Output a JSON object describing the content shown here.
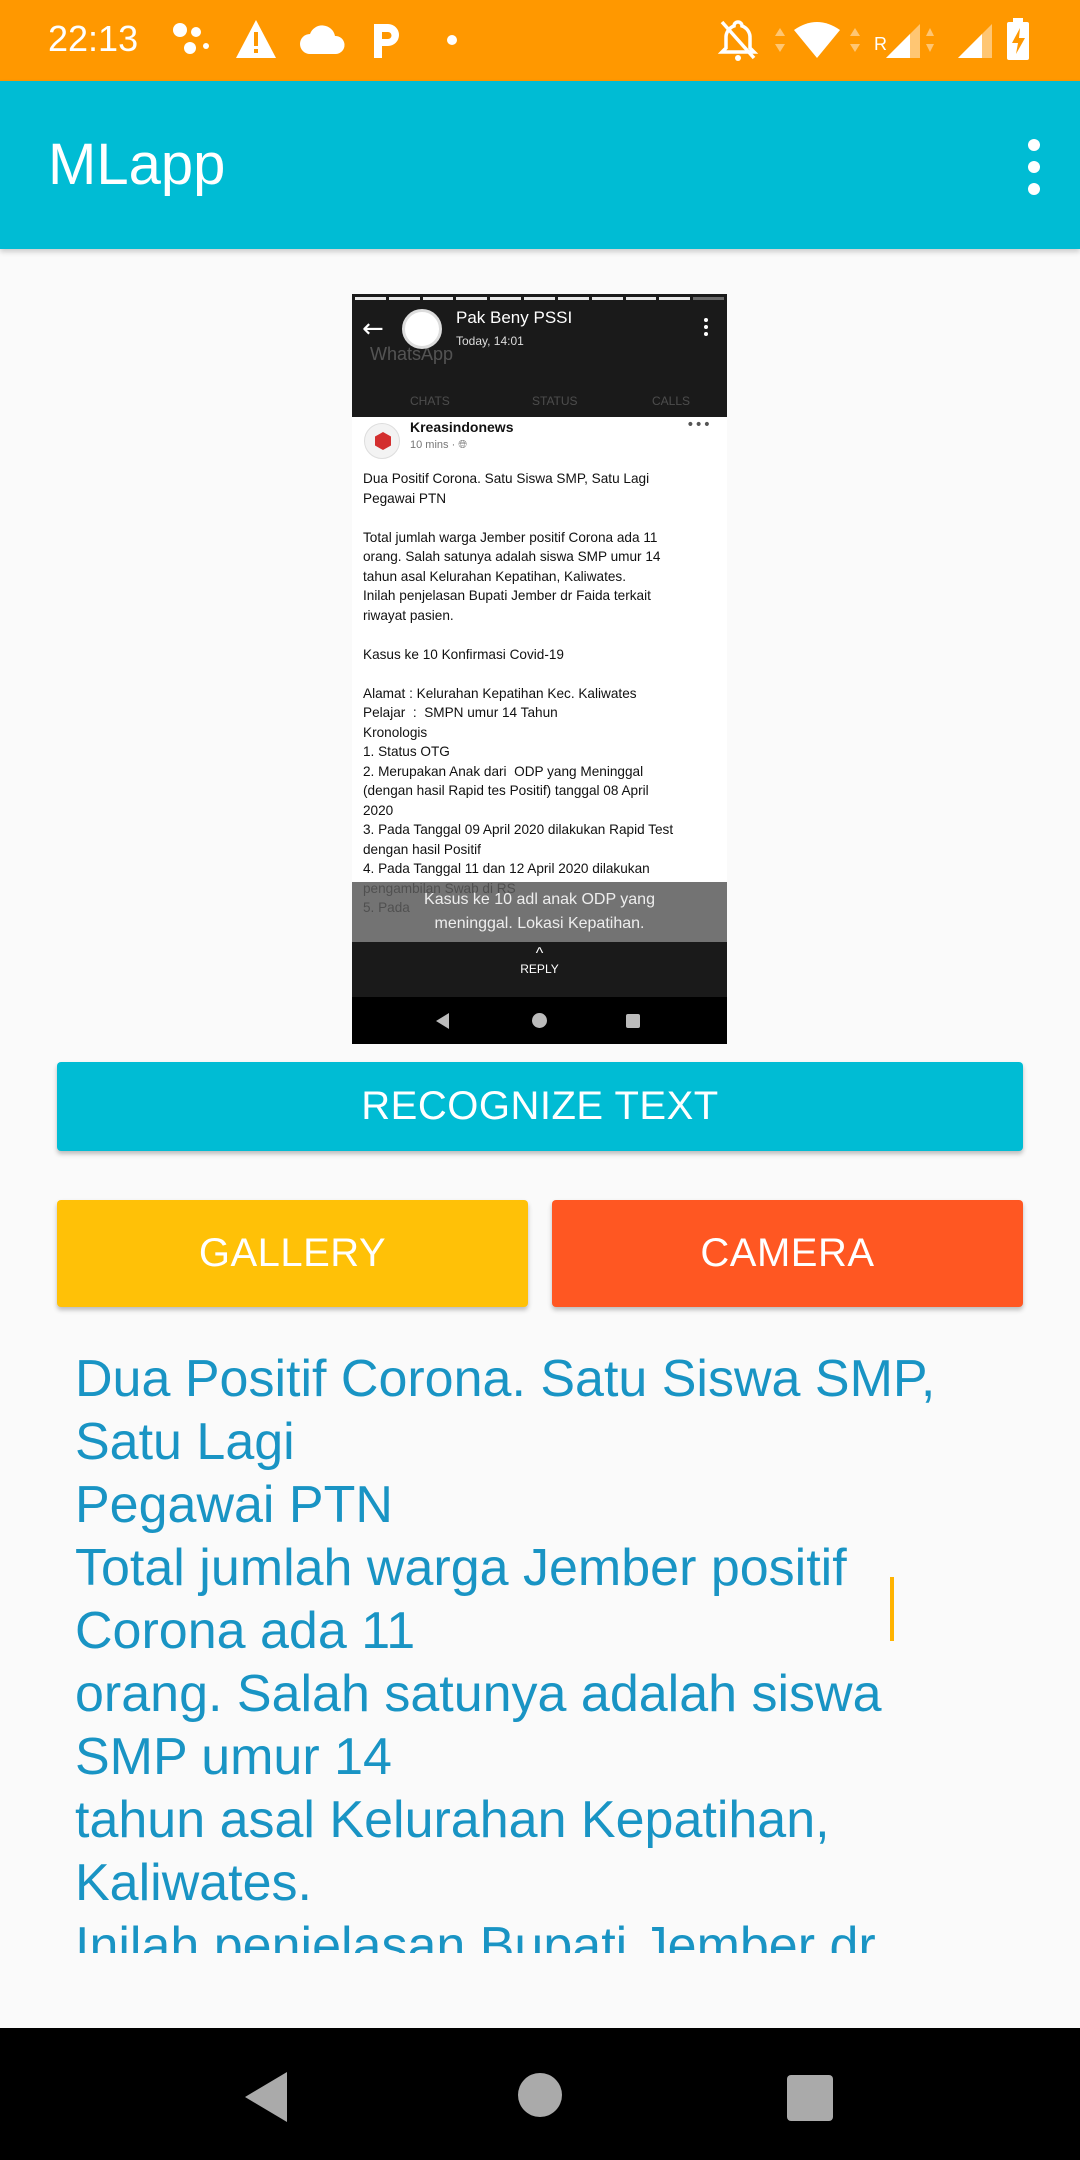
{
  "status_bar": {
    "time": "22:13",
    "icons": [
      "assistant-icon",
      "warning-icon",
      "cloud-icon",
      "p-icon",
      "dot-icon",
      "notifications-off-icon",
      "wifi-icon",
      "signal-roaming-icon",
      "signal-icon",
      "battery-charging-icon"
    ],
    "roaming_label": "R"
  },
  "app_bar": {
    "title": "MLapp",
    "menu_icon": "more-vert-icon"
  },
  "preview": {
    "contact_name": "Pak Beny PSSI",
    "contact_time": "Today, 14:01",
    "ghost_app_title": "WhatsApp",
    "ghost_tabs": [
      "CHATS",
      "STATUS",
      "CALLS"
    ],
    "post_author": "Kreasindonews",
    "post_time": "10 mins · ",
    "post_text": "Dua Positif Corona. Satu Siswa SMP, Satu Lagi\nPegawai PTN\n\nTotal jumlah warga Jember positif Corona ada 11\norang. Salah satunya adalah siswa SMP umur 14\ntahun asal Kelurahan Kepatihan, Kaliwates.\nInilah penjelasan Bupati Jember dr Faida terkait\nriwayat pasien.\n\nKasus ke 10 Konfirmasi Covid-19\n\nAlamat : Kelurahan Kepatihan Kec. Kaliwates\nPelajar  :  SMPN umur 14 Tahun\nKronologis\n1. Status OTG\n2. Merupakan Anak dari  ODP yang Meninggal\n(dengan hasil Rapid tes Positif) tanggal 08 April\n2020\n3. Pada Tanggal 09 April 2020 dilakukan Rapid Test\ndengan hasil Positif\n4. Pada Tanggal 11 dan 12 April 2020 dilakukan\npengambilan Swab di RS\n5. Pada",
    "caption": "Kasus ke 10 adl anak ODP yang\nmeninggal. Lokasi Kepatihan.",
    "reply_label": "REPLY"
  },
  "buttons": {
    "recognize": "RECOGNIZE TEXT",
    "gallery": "GALLERY",
    "camera": "CAMERA"
  },
  "result_text": "Dua Positif Corona. Satu Siswa SMP,\nSatu Lagi\nPegawai PTN\nTotal jumlah warga Jember positif\nCorona ada 11\norang. Salah satunya adalah siswa\nSMP umur 14\ntahun asal Kelurahan Kepatihan,\nKaliwates.\nInilah penjelasan Bupati Jember dr",
  "colors": {
    "status_bar": "#ff9800",
    "app_bar": "#00bcd4",
    "recognize_button": "#00bcd4",
    "gallery_button": "#ffc107",
    "camera_button": "#ff5722",
    "result_text": "#1994c4",
    "caret": "#ffb300"
  }
}
